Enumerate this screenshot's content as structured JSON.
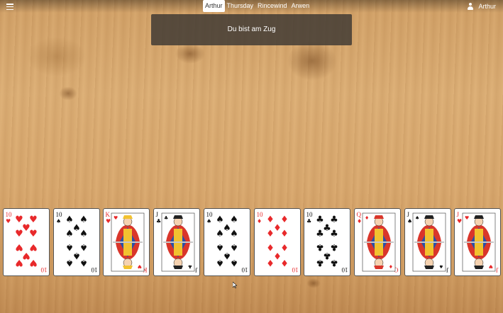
{
  "players": [
    "Arthur",
    "Thursday",
    "Rincewind",
    "Arwen"
  ],
  "active_player": 0,
  "user": {
    "name": "Arthur"
  },
  "status": {
    "text": "Du bist am Zug"
  },
  "hand": [
    {
      "rank": "10",
      "suit": "hearts"
    },
    {
      "rank": "10",
      "suit": "spades"
    },
    {
      "rank": "K",
      "suit": "hearts"
    },
    {
      "rank": "J",
      "suit": "clubs"
    },
    {
      "rank": "10",
      "suit": "spades"
    },
    {
      "rank": "10",
      "suit": "diamonds"
    },
    {
      "rank": "10",
      "suit": "clubs"
    },
    {
      "rank": "Q",
      "suit": "diamonds"
    },
    {
      "rank": "J",
      "suit": "spades"
    },
    {
      "rank": "J",
      "suit": "hearts"
    }
  ],
  "colors": {
    "red": "#e8292b",
    "black": "#111111",
    "status_bg": "#3c3732"
  },
  "icons": {
    "menu": "hamburger-icon",
    "user": "user-icon"
  }
}
